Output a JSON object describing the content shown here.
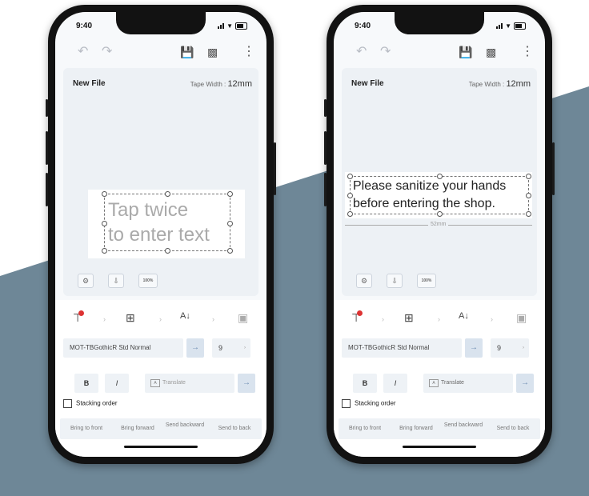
{
  "phones": [
    {
      "status_time": "9:40",
      "file_title": "New File",
      "tape_width_label": "Tape Width : ",
      "tape_width_value": "12mm",
      "label_lines": [
        "Tap twice",
        "to enter text"
      ],
      "is_placeholder": true,
      "measure_text": "",
      "zoom_label": "100%",
      "font_name": "MOT-TBGothicR Std Normal",
      "font_size": "9",
      "bold_label": "B",
      "italic_label": "I",
      "translate_placeholder": "Translate",
      "stacking_order_label": "Stacking order",
      "stack_actions": [
        "Bring to front",
        "Bring forward",
        "Send backward",
        "Send to back"
      ]
    },
    {
      "status_time": "9:40",
      "file_title": "New File",
      "tape_width_label": "Tape Width : ",
      "tape_width_value": "12mm",
      "label_lines": [
        "Please sanitize your hands",
        "before entering the shop."
      ],
      "is_placeholder": false,
      "measure_text": "52mm",
      "zoom_label": "100%",
      "font_name": "MOT-TBGothicR Std Normal",
      "font_size": "9",
      "bold_label": "B",
      "italic_label": "I",
      "translate_placeholder": "Translate",
      "stacking_order_label": "Stacking order",
      "stack_actions": [
        "Bring to front",
        "Bring forward",
        "Send backward",
        "Send to back"
      ]
    }
  ],
  "icons": {
    "undo": "undo-icon",
    "redo": "redo-icon",
    "save": "save-icon",
    "print": "print-icon",
    "more": "more-icon",
    "settings": "gear-icon",
    "import": "import-icon"
  },
  "colors": {
    "background_band": "#6e8797",
    "accent_arrow": "#6a8bb0"
  }
}
